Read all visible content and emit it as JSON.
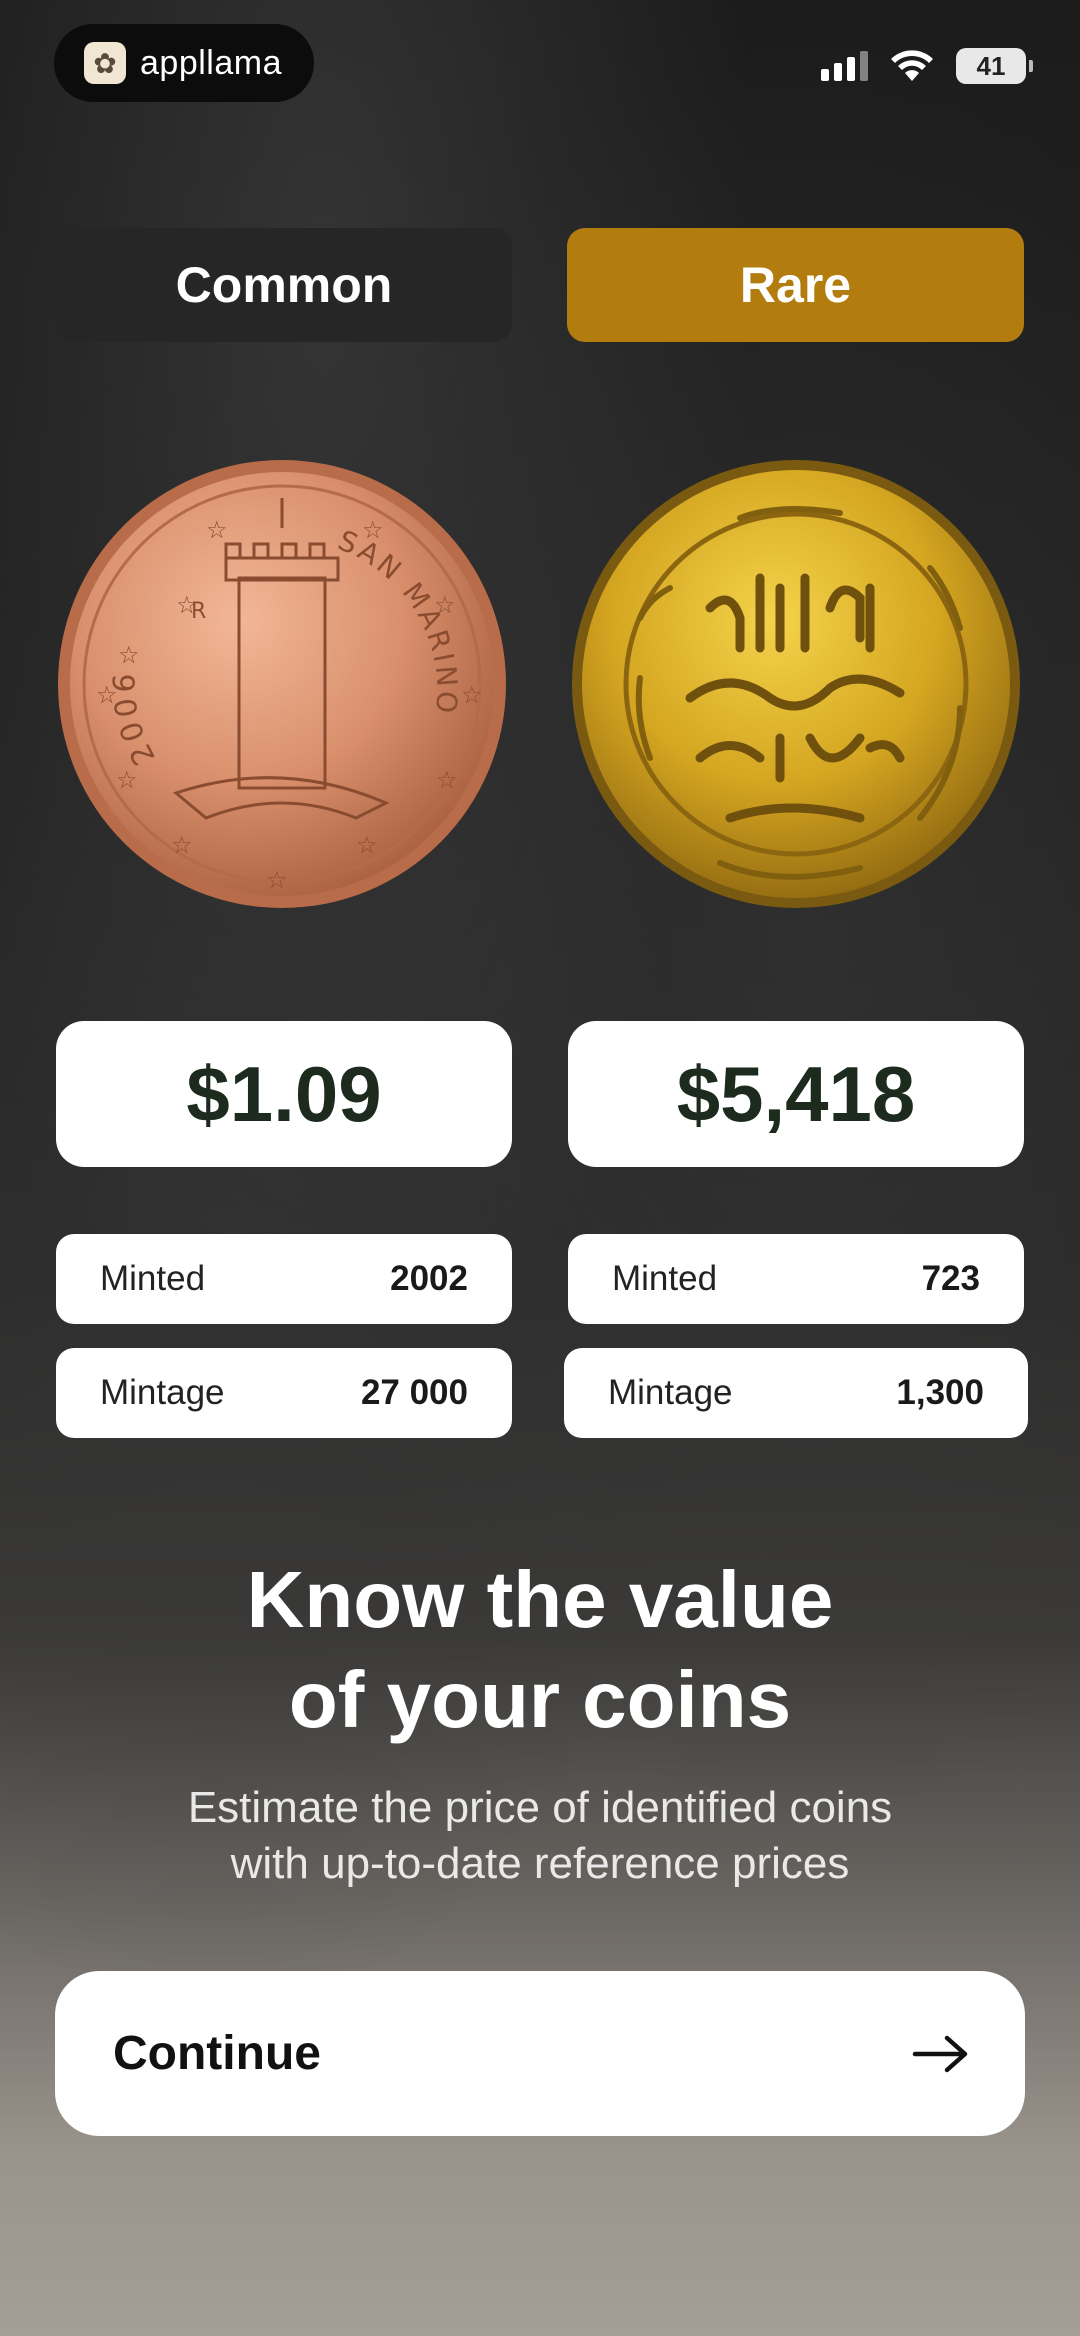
{
  "status_bar": {
    "brand_name": "appllama",
    "battery": "41"
  },
  "tabs": {
    "common": "Common",
    "rare": "Rare"
  },
  "coins": {
    "common": {
      "year_text": "2006",
      "country_text": "SAN MARINO",
      "price": "$1.09",
      "stats": [
        {
          "label": "Minted",
          "value": "2002"
        },
        {
          "label": "Mintage",
          "value": "27 000"
        }
      ]
    },
    "rare": {
      "price": "$5,418",
      "stats": [
        {
          "label": "Minted",
          "value": "723"
        },
        {
          "label": "Mintage",
          "value": "1,300"
        }
      ]
    }
  },
  "headline": {
    "line1": "Know the value",
    "line2": "of your coins"
  },
  "subline": {
    "line1": "Estimate the price of identified coins",
    "line2": "with up-to-date reference prices"
  },
  "continue_button": {
    "label": "Continue"
  },
  "colors": {
    "rare_accent": "#b27d0e",
    "common_tab": "#262626",
    "price_text": "#1d2b1f"
  },
  "icons": [
    "cellular-signal-icon",
    "wifi-icon",
    "battery-icon",
    "arrow-right-icon",
    "llama-logo-icon"
  ]
}
